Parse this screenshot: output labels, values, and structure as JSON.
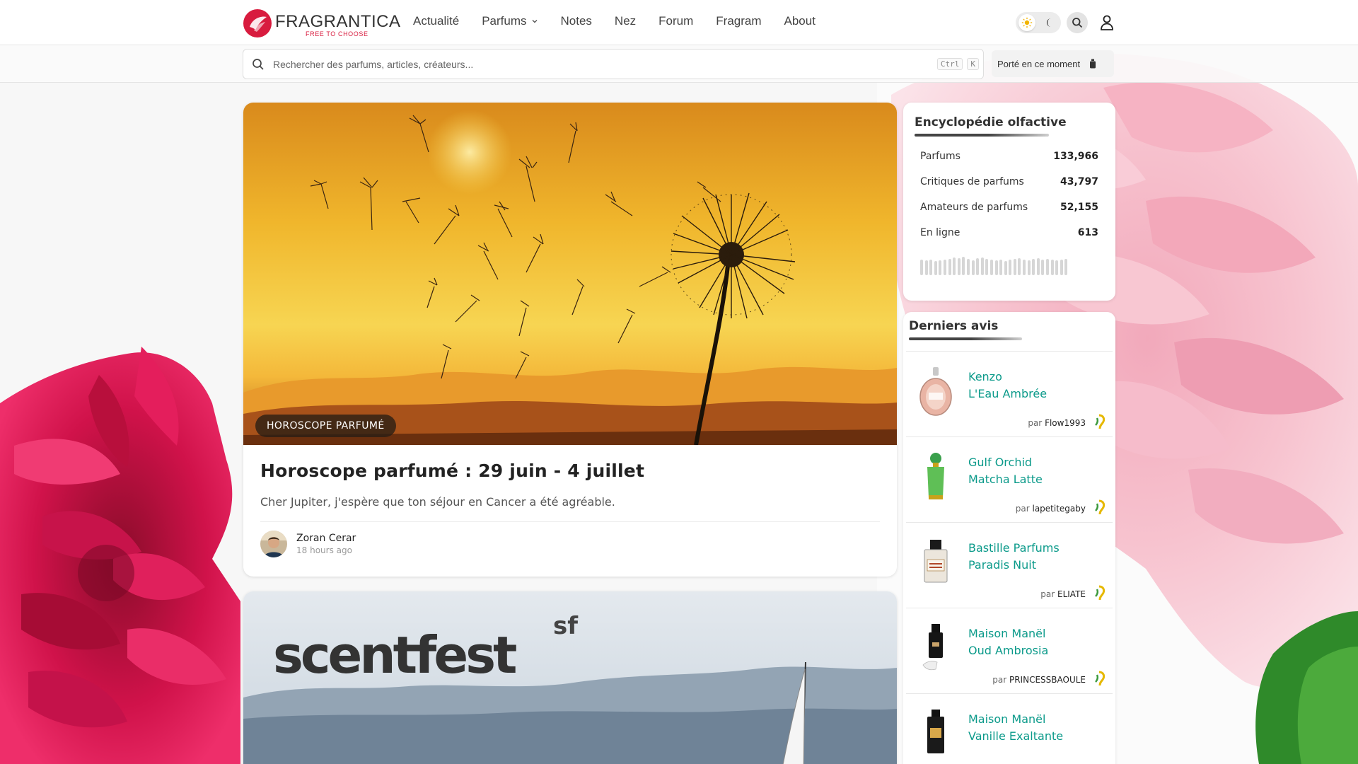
{
  "header": {
    "logo_name": "FRAGRANTICA",
    "logo_tagline": "FREE TO CHOOSE",
    "nav": [
      {
        "label": "Actualité"
      },
      {
        "label": "Parfums",
        "has_dropdown": true
      },
      {
        "label": "Notes"
      },
      {
        "label": "Nez"
      },
      {
        "label": "Forum"
      },
      {
        "label": "Fragram"
      },
      {
        "label": "About"
      }
    ],
    "icons": {
      "theme_light": "sun-icon",
      "theme_dark": "moon-icon",
      "search": "search-icon",
      "user": "user-icon"
    }
  },
  "search": {
    "placeholder": "Rechercher des parfums, articles, créateurs...",
    "shortcut_keys": [
      "Ctrl",
      "K"
    ],
    "worn_now_label": "Porté en ce moment"
  },
  "feed": {
    "articles": [
      {
        "category": "HOROSCOPE PARFUMÉ",
        "title": "Horoscope parfumé : 29 juin - 4 juillet",
        "subtitle": "Cher Jupiter, j'espère que ton séjour en Cancer a été agréable.",
        "author": "Zoran Cerar",
        "time": "18 hours ago"
      },
      {
        "hero_logo_text": "scentfest",
        "hero_logo_sup": "sf"
      }
    ]
  },
  "sidebar": {
    "encyclopedia": {
      "title": "Encyclopédie olfactive",
      "stats": [
        {
          "label": "Parfums",
          "value": "133,966"
        },
        {
          "label": "Critiques de parfums",
          "value": "43,797"
        },
        {
          "label": "Amateurs de parfums",
          "value": "52,155"
        },
        {
          "label": "En ligne",
          "value": "613"
        }
      ]
    },
    "reviews": {
      "title": "Derniers avis",
      "by_prefix": "par",
      "items": [
        {
          "brand": "Kenzo",
          "name": "L'Eau Ambrée",
          "user": "Flow1993"
        },
        {
          "brand": "Gulf Orchid",
          "name": "Matcha Latte",
          "user": "lapetitegaby"
        },
        {
          "brand": "Bastille Parfums",
          "name": "Paradis Nuit",
          "user": "ELIATE"
        },
        {
          "brand": "Maison Manël",
          "name": "Oud Ambrosia",
          "user": "PRINCESSBAOULE"
        },
        {
          "brand": "Maison Manël",
          "name": "Vanille Exaltante",
          "user": ""
        }
      ]
    }
  },
  "colors": {
    "brand_red": "#d81b3e",
    "link_teal": "#0b9a8a",
    "page_bg": "#f7f7f7"
  }
}
